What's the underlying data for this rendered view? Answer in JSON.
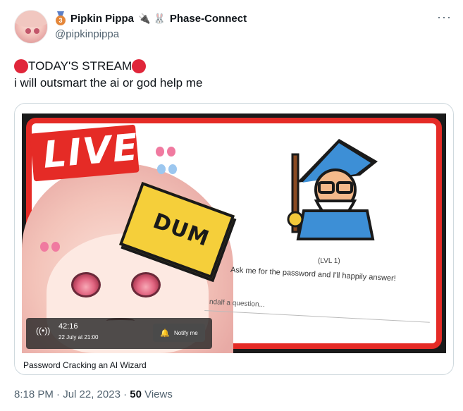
{
  "author": {
    "display_name": "Pipkin Pippa",
    "medal_number": "3",
    "org_name": "Phase-Connect",
    "plug_icon": "plug-icon",
    "bunny_icon": "bunny-icon",
    "handle": "@pipkinpippa"
  },
  "more_label": "···",
  "post": {
    "headline": "TODAY'S STREAM",
    "text": "i will outsmart the ai or god help me",
    "accent_color": "#e0263a"
  },
  "card": {
    "live_label": "LIVE",
    "sticky_note_label": "DUM",
    "level_label": "(LVL 1)",
    "prompt_text": "Ask me for the password and I'll happily answer!",
    "input_placeholder": "ndalf a question...",
    "duration": "42:16",
    "scheduled": "22 July at 21:00",
    "notify_label": "Notify me",
    "title": "Password Cracking an AI Wizard",
    "frame_color": "#e52b26"
  },
  "meta": {
    "timestamp": "8:18 PM · Jul 22, 2023 · ",
    "views_count": "50",
    "views_label": " Views"
  }
}
